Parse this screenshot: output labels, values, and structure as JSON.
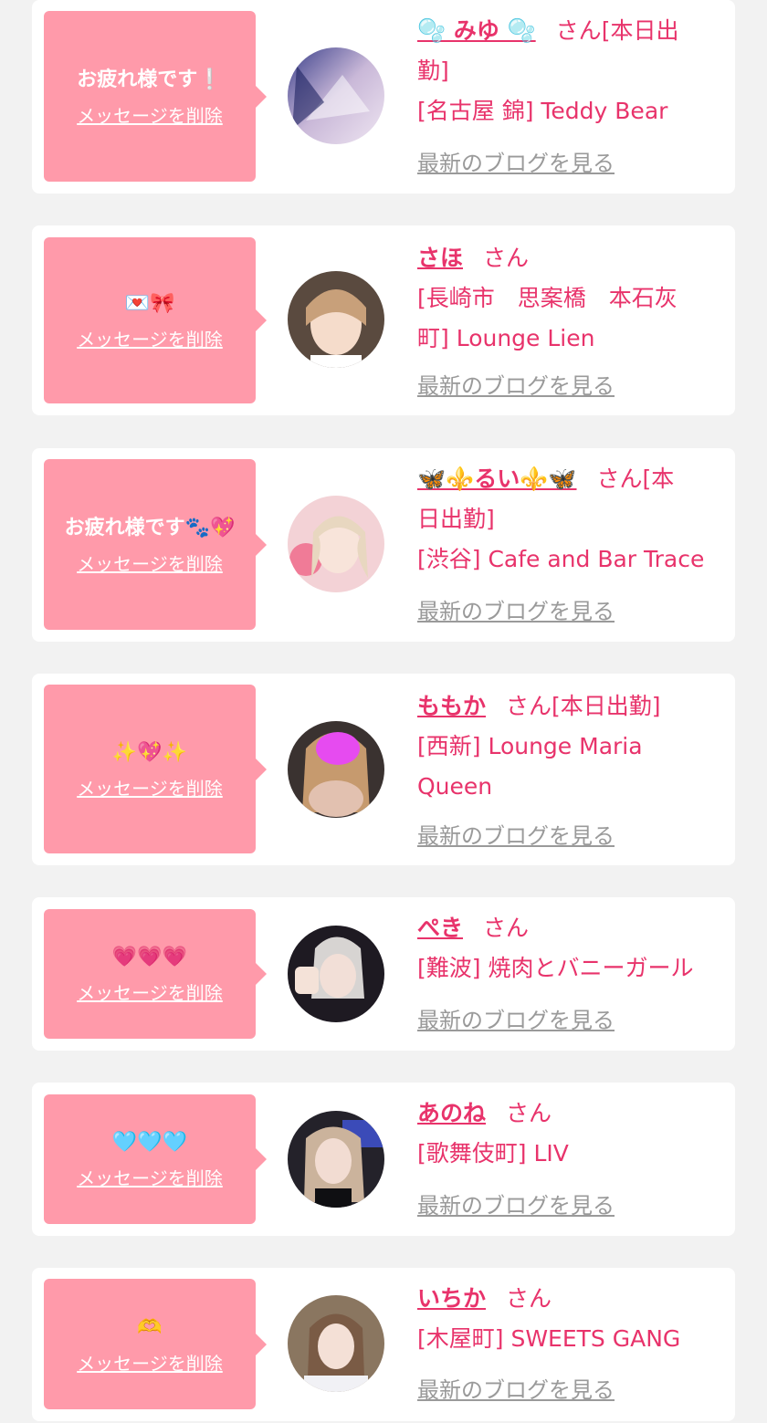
{
  "delete_label": "メッセージを削除",
  "blog_label": "最新のブログを見る",
  "honorific": "さん",
  "colors": {
    "background": "#f2f2f2",
    "card": "#ffffff",
    "bubble": "#ff9aaa",
    "accent": "#e8336b",
    "link_gray": "#9a9a9a"
  },
  "cards": [
    {
      "message": "お疲れ様です❕",
      "name": "🫧 みゆ 🫧",
      "line1_suffix": "[本日出",
      "line2": "勤]",
      "line3": "[名古屋 錦] Teddy Bear",
      "avatar_icon": "avatar-photo"
    },
    {
      "message": "💌🎀",
      "name": "さほ",
      "line1_suffix": "",
      "line2": "[長崎市　思案橋　本石灰",
      "line3": "町] Lounge Lien",
      "avatar_icon": "avatar-photo"
    },
    {
      "message": "お疲れ様です🐾💖",
      "name": "🦋⚜️るい⚜️🦋",
      "line1_suffix": "[本",
      "line2": "日出勤]",
      "line3": "[渋谷] Cafe and Bar Trace",
      "avatar_icon": "avatar-photo"
    },
    {
      "message": "✨💖✨",
      "name": "ももか",
      "line1_suffix": "[本日出勤]",
      "line2": "[西新] Lounge Maria",
      "line3": "Queen",
      "avatar_icon": "avatar-photo"
    },
    {
      "message": "💗💗💗",
      "name": "ぺき",
      "line1_suffix": "",
      "line2": "[難波] 焼肉とバニーガール",
      "line3": "",
      "avatar_icon": "avatar-photo"
    },
    {
      "message": "🩵🩵🩵",
      "name": "あのね",
      "line1_suffix": "",
      "line2": "[歌舞伎町] LIV",
      "line3": "",
      "avatar_icon": "avatar-photo"
    },
    {
      "message": "🫶",
      "name": "いちか",
      "line1_suffix": "",
      "line2": "[木屋町] SWEETS GANG",
      "line3": "",
      "avatar_icon": "avatar-photo"
    }
  ]
}
